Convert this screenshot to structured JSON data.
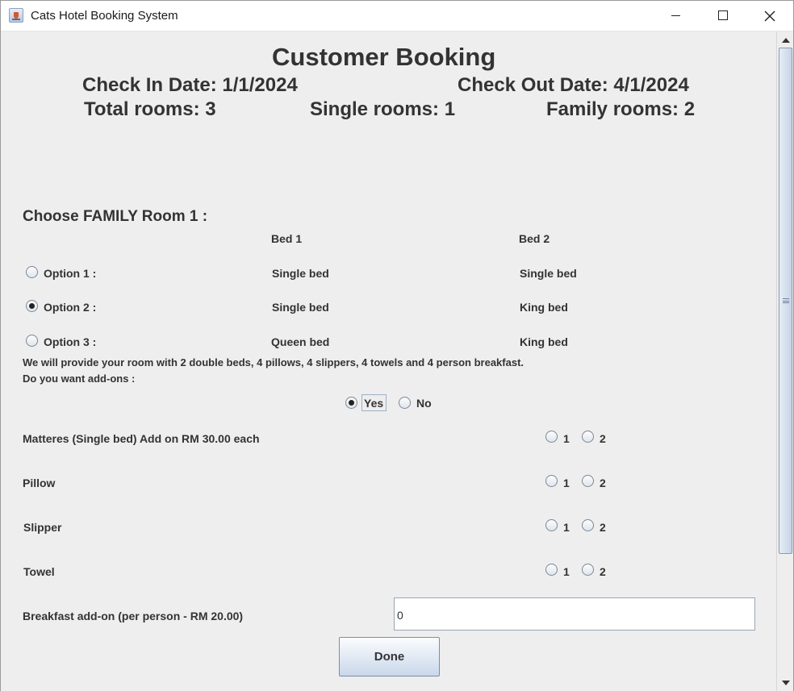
{
  "window": {
    "title": "Cats Hotel Booking System"
  },
  "header": {
    "title": "Customer Booking",
    "check_in": "Check In Date: 1/1/2024",
    "check_out": "Check Out Date: 4/1/2024",
    "total_rooms": "Total rooms: 3",
    "single_rooms": "Single rooms: 1",
    "family_rooms": "Family rooms: 2"
  },
  "room_choice": {
    "heading": "Choose FAMILY Room 1 :",
    "col_bed1": "Bed 1",
    "col_bed2": "Bed 2",
    "options": [
      {
        "label": "Option 1 :",
        "bed1": "Single bed",
        "bed2": "Single bed",
        "selected": false
      },
      {
        "label": "Option 2 :",
        "bed1": "Single bed",
        "bed2": "King bed",
        "selected": true
      },
      {
        "label": "Option 3 :",
        "bed1": "Queen bed",
        "bed2": "King bed",
        "selected": false
      }
    ]
  },
  "info": {
    "provide_text": "We will provide your room with 2 double beds, 4 pillows, 4 slippers, 4 towels and 4 person breakfast.",
    "addons_question": "Do you want add-ons :",
    "yes_label": "Yes",
    "no_label": "No",
    "addons_selected": "Yes"
  },
  "addons": [
    {
      "label": "Matteres (Single bed) Add on RM 30.00 each",
      "opt1": "1",
      "opt2": "2"
    },
    {
      "label": "Pillow",
      "opt1": "1",
      "opt2": "2"
    },
    {
      "label": "Slipper",
      "opt1": "1",
      "opt2": "2"
    },
    {
      "label": "Towel",
      "opt1": "1",
      "opt2": "2"
    }
  ],
  "breakfast": {
    "label": "Breakfast add-on (per person - RM 20.00)",
    "value": "0"
  },
  "done_label": "Done"
}
